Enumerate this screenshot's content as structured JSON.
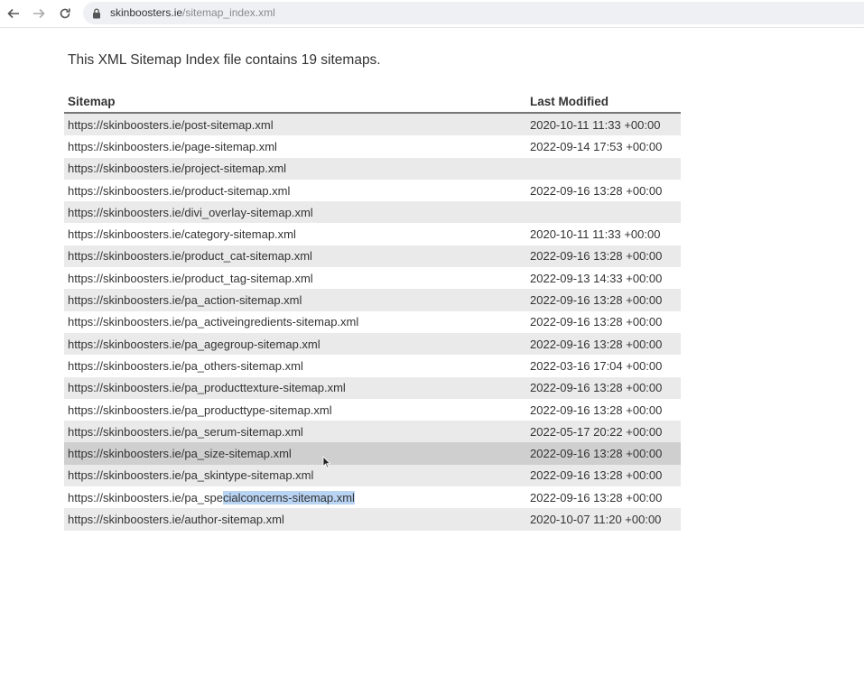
{
  "browser": {
    "url_host": "skinboosters.ie",
    "url_path": "/sitemap_index.xml"
  },
  "page": {
    "intro": "This XML Sitemap Index file contains 19 sitemaps.",
    "columns": {
      "sitemap": "Sitemap",
      "last_modified": "Last Modified"
    },
    "rows": [
      {
        "url": "https://skinboosters.ie/post-sitemap.xml",
        "modified": "2020-10-11 11:33 +00:00"
      },
      {
        "url": "https://skinboosters.ie/page-sitemap.xml",
        "modified": "2022-09-14 17:53 +00:00"
      },
      {
        "url": "https://skinboosters.ie/project-sitemap.xml",
        "modified": ""
      },
      {
        "url": "https://skinboosters.ie/product-sitemap.xml",
        "modified": "2022-09-16 13:28 +00:00"
      },
      {
        "url": "https://skinboosters.ie/divi_overlay-sitemap.xml",
        "modified": ""
      },
      {
        "url": "https://skinboosters.ie/category-sitemap.xml",
        "modified": "2020-10-11 11:33 +00:00"
      },
      {
        "url": "https://skinboosters.ie/product_cat-sitemap.xml",
        "modified": "2022-09-16 13:28 +00:00"
      },
      {
        "url": "https://skinboosters.ie/product_tag-sitemap.xml",
        "modified": "2022-09-13 14:33 +00:00"
      },
      {
        "url": "https://skinboosters.ie/pa_action-sitemap.xml",
        "modified": "2022-09-16 13:28 +00:00"
      },
      {
        "url": "https://skinboosters.ie/pa_activeingredients-sitemap.xml",
        "modified": "2022-09-16 13:28 +00:00"
      },
      {
        "url": "https://skinboosters.ie/pa_agegroup-sitemap.xml",
        "modified": "2022-09-16 13:28 +00:00"
      },
      {
        "url": "https://skinboosters.ie/pa_others-sitemap.xml",
        "modified": "2022-03-16 17:04 +00:00"
      },
      {
        "url": "https://skinboosters.ie/pa_producttexture-sitemap.xml",
        "modified": "2022-09-16 13:28 +00:00"
      },
      {
        "url": "https://skinboosters.ie/pa_producttype-sitemap.xml",
        "modified": "2022-09-16 13:28 +00:00"
      },
      {
        "url": "https://skinboosters.ie/pa_serum-sitemap.xml",
        "modified": "2022-05-17 20:22 +00:00"
      },
      {
        "url": "https://skinboosters.ie/pa_size-sitemap.xml",
        "modified": "2022-09-16 13:28 +00:00"
      },
      {
        "url": "https://skinboosters.ie/pa_skintype-sitemap.xml",
        "modified": "2022-09-16 13:28 +00:00"
      },
      {
        "url_before": "https://skinboosters.ie/pa_spe",
        "url_selected": "cialconcerns-sitemap.xml",
        "modified": "2022-09-16 13:28 +00:00"
      },
      {
        "url": "https://skinboosters.ie/author-sitemap.xml",
        "modified": "2020-10-07 11:20 +00:00"
      }
    ]
  },
  "icons": [
    "back-arrow-icon",
    "forward-arrow-icon",
    "reload-icon",
    "lock-icon",
    "mouse-cursor-icon"
  ],
  "colors": {
    "row_alt": "#eaeaea",
    "row_hover": "#cfcfcf",
    "selection": "#b9d3f3"
  }
}
